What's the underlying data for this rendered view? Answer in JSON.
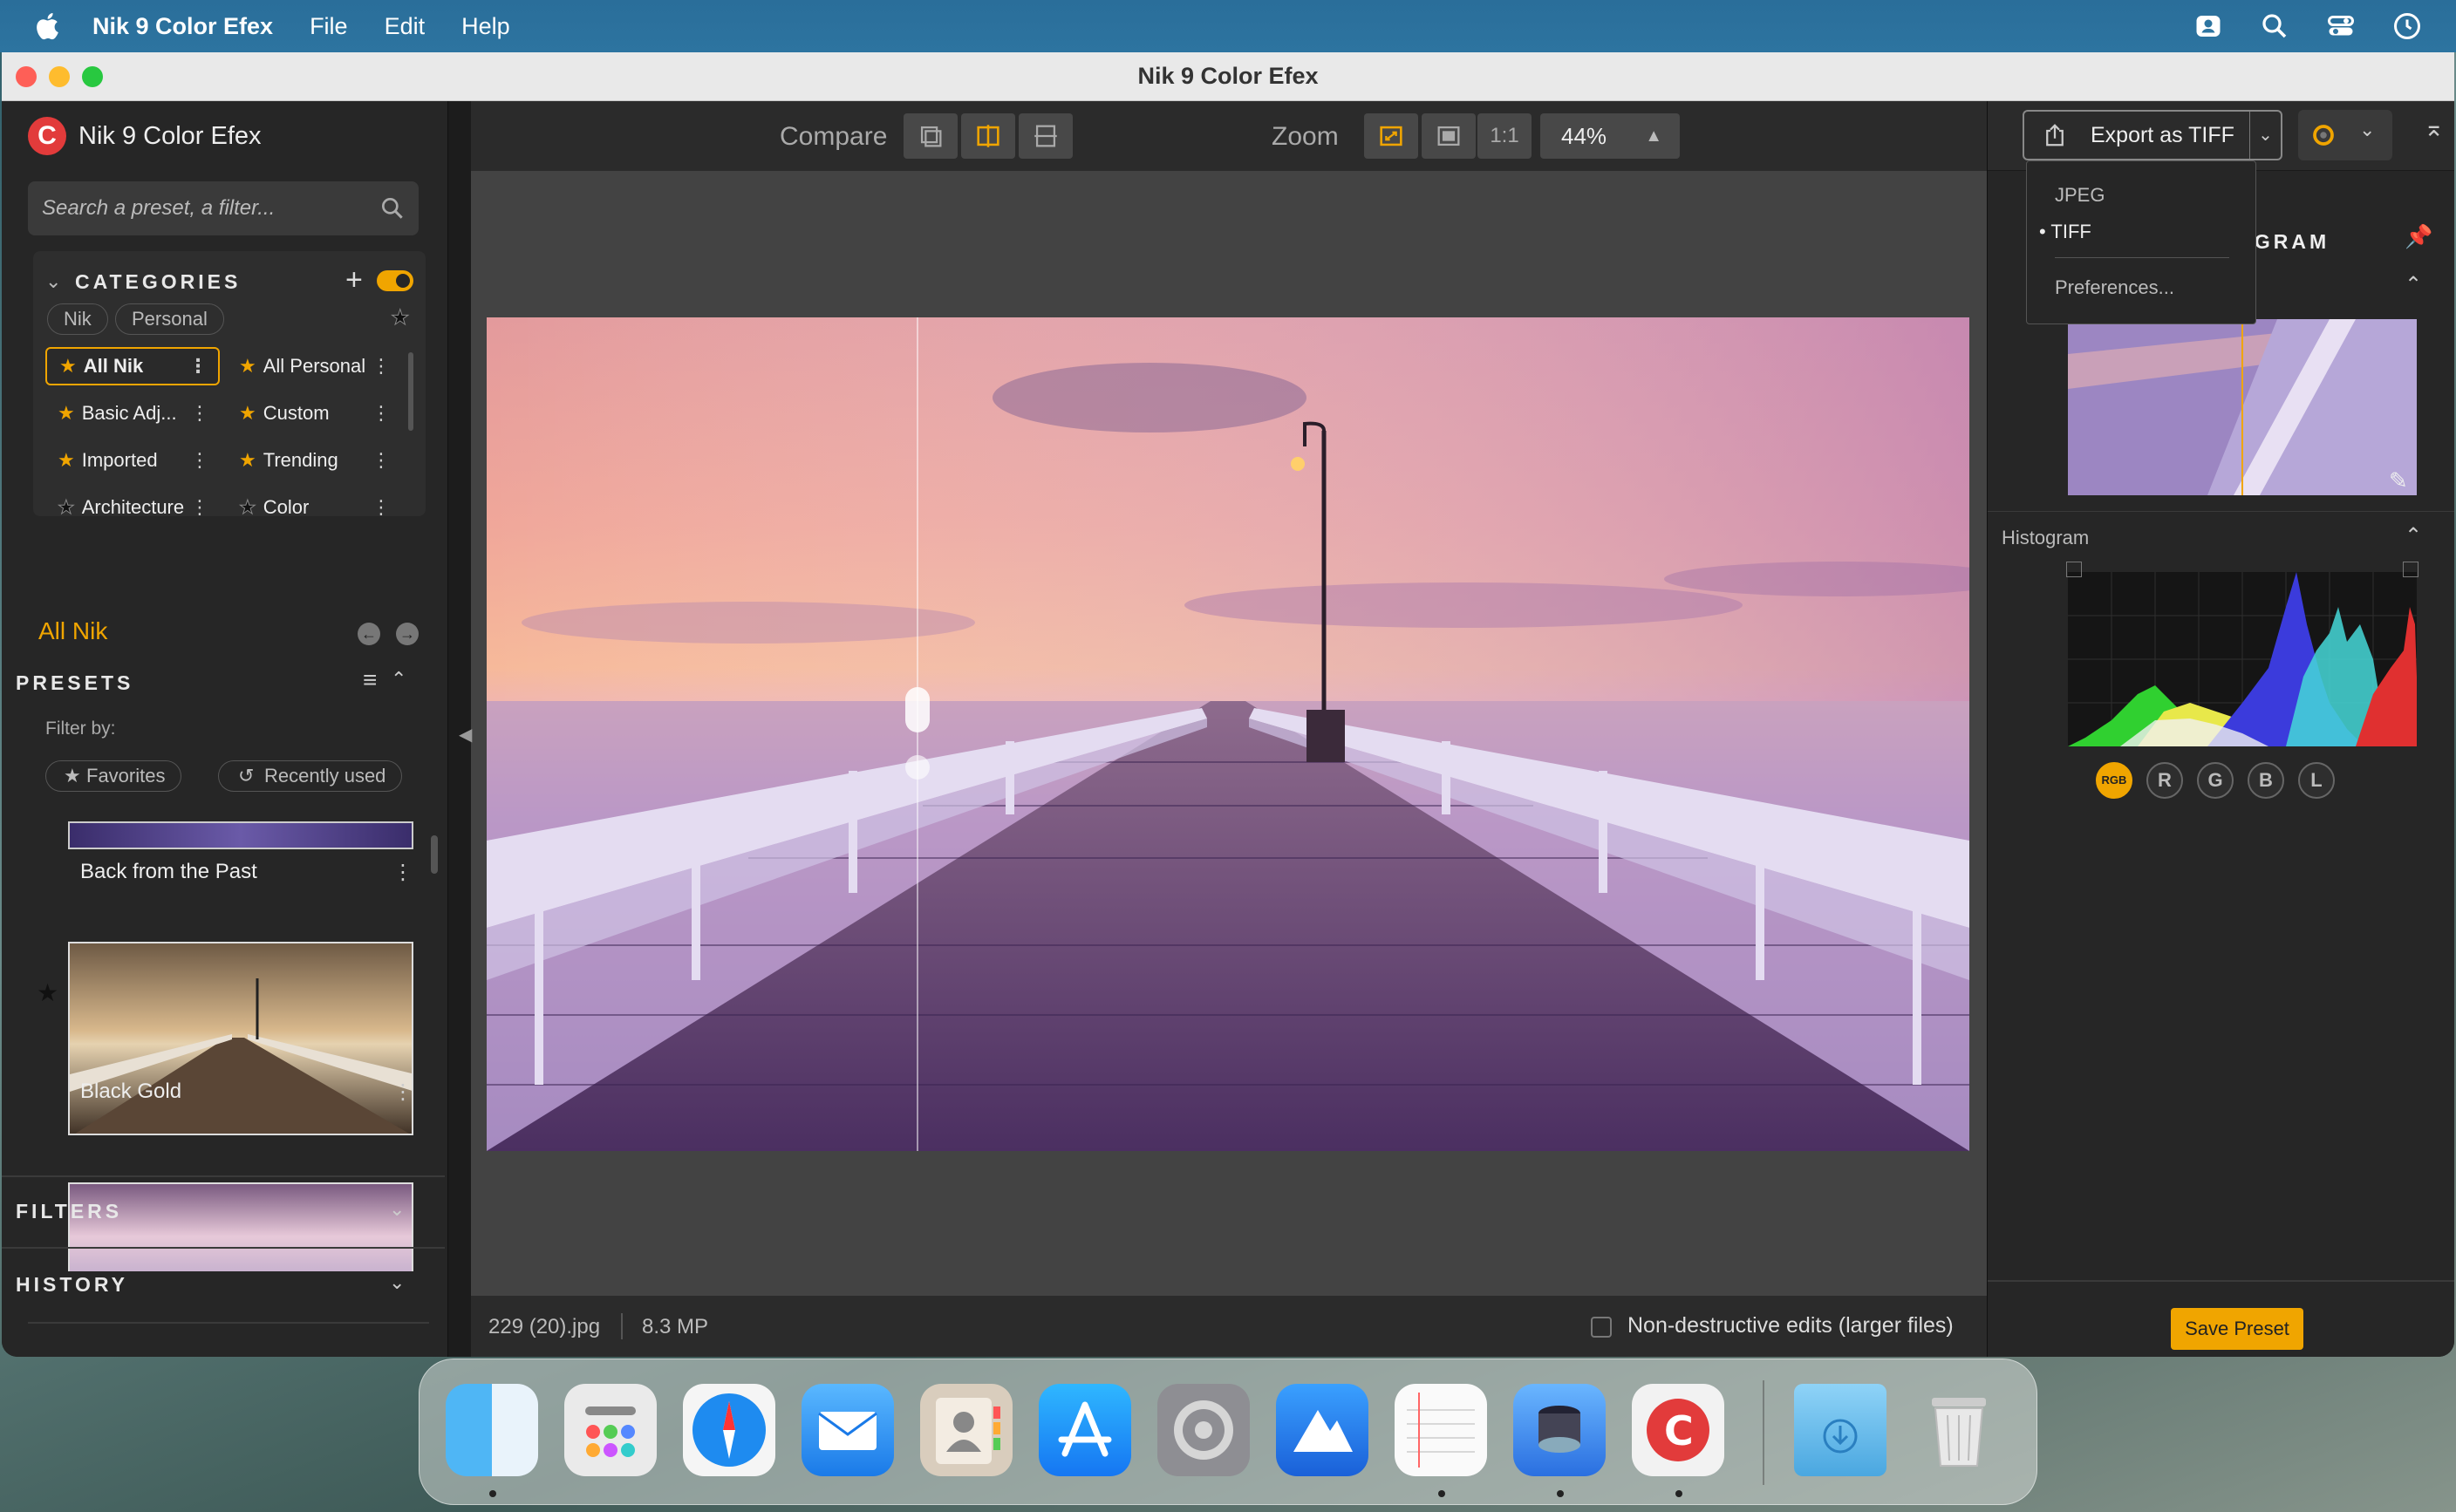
{
  "menubar": {
    "app_name": "Nik 9 Color Efex",
    "items": [
      "File",
      "Edit",
      "Help"
    ]
  },
  "window": {
    "title": "Nik 9 Color Efex"
  },
  "sidebar": {
    "brand": "Nik 9 Color Efex",
    "search_placeholder": "Search a preset, a filter...",
    "categories_title": "CATEGORIES",
    "tabs": [
      "Nik",
      "Personal"
    ],
    "categories": [
      {
        "label": "All Nik",
        "starred": true,
        "selected": true
      },
      {
        "label": "All Personal",
        "starred": true
      },
      {
        "label": "Basic Adj...",
        "starred": true
      },
      {
        "label": "Custom",
        "starred": true
      },
      {
        "label": "Imported",
        "starred": true
      },
      {
        "label": "Trending",
        "starred": true
      },
      {
        "label": "Architecture",
        "starred": false
      },
      {
        "label": "Color",
        "starred": false
      }
    ],
    "current": "All Nik",
    "presets_title": "PRESETS",
    "filter_by": "Filter by:",
    "filter_favorites": "Favorites",
    "filter_recent": "Recently used",
    "presets": [
      {
        "name": "Back from the Past"
      },
      {
        "name": "Black Gold"
      }
    ],
    "filters_title": "FILTERS",
    "history_title": "HISTORY"
  },
  "toolbar": {
    "compare_label": "Compare",
    "zoom_label": "Zoom",
    "zoom_1to1": "1:1",
    "zoom_value": "44%"
  },
  "status": {
    "filename": "229 (20).jpg",
    "megapixels": "8.3 MP",
    "nondestructive_label": "Non-destructive edits (larger files)"
  },
  "right": {
    "export_label": "Export as TIFF",
    "export_menu": [
      "JPEG",
      "TIFF",
      "Preferences..."
    ],
    "export_selected": "TIFF",
    "loupe_title": "OGRAM",
    "histogram_title": "Histogram",
    "channels": [
      "RGB",
      "R",
      "G",
      "B",
      "L"
    ],
    "save_preset": "Save Preset"
  },
  "colors": {
    "accent": "#f0a500",
    "brand_red": "#e23b3b"
  },
  "dock": {
    "apps": [
      "finder-icon",
      "launchpad-icon",
      "safari-icon",
      "mail-icon",
      "contacts-icon",
      "app-store-icon",
      "system-settings-icon",
      "affinity-icon",
      "textedit-icon",
      "preview-icon",
      "nik-color-efex-icon",
      "downloads-icon",
      "trash-icon"
    ]
  }
}
